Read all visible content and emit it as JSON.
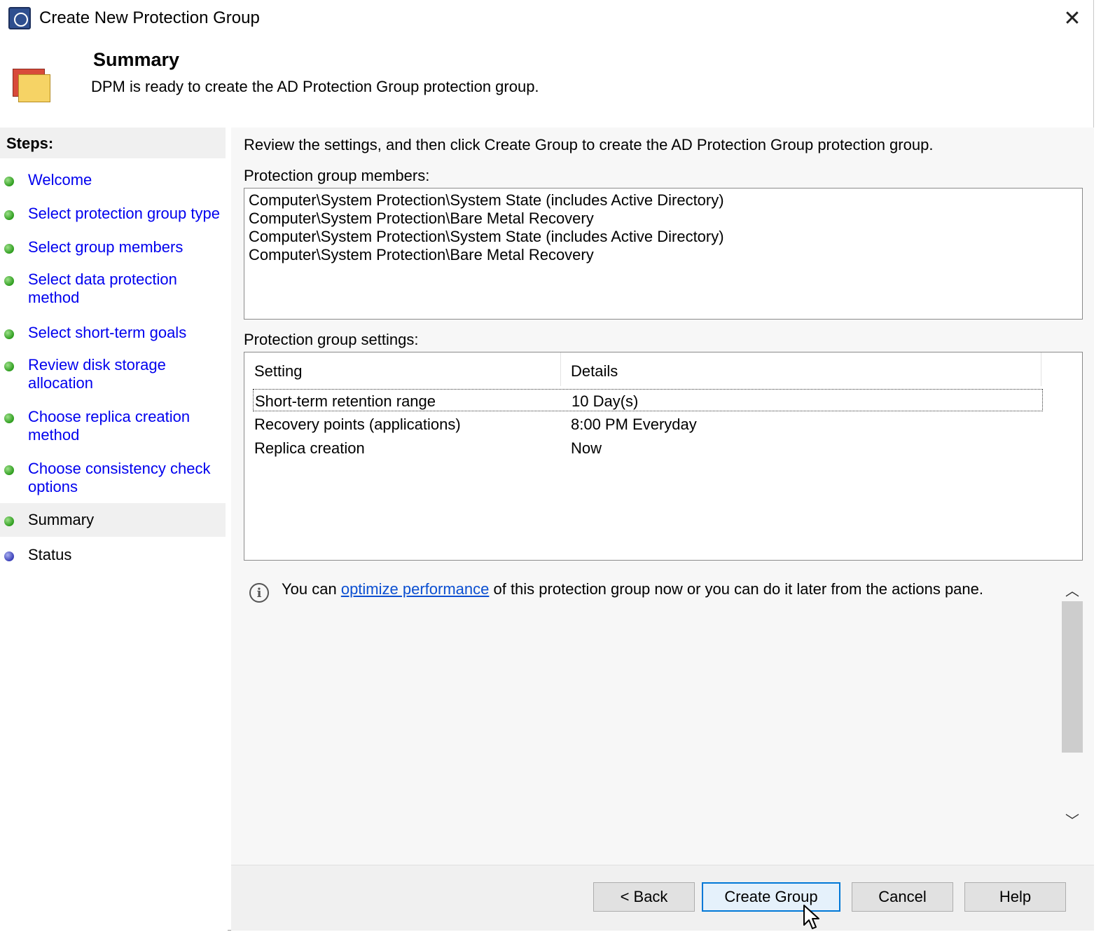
{
  "window": {
    "title": "Create New Protection Group",
    "close_glyph": "✕"
  },
  "header": {
    "title": "Summary",
    "subtitle": "DPM is ready to create the AD Protection Group protection group."
  },
  "steps": {
    "heading": "Steps:",
    "items": [
      {
        "label": "Welcome",
        "state": "done"
      },
      {
        "label": "Select protection group type",
        "state": "done"
      },
      {
        "label": "Select group members",
        "state": "done"
      },
      {
        "label": "Select data protection method",
        "state": "done"
      },
      {
        "label": "Select short-term goals",
        "state": "done"
      },
      {
        "label": "Review disk storage allocation",
        "state": "done"
      },
      {
        "label": "Choose replica creation method",
        "state": "done"
      },
      {
        "label": "Choose consistency check options",
        "state": "done"
      },
      {
        "label": "Summary",
        "state": "current"
      },
      {
        "label": "Status",
        "state": "pending"
      }
    ]
  },
  "main": {
    "intro": "Review the settings, and then click Create Group to create the AD Protection Group protection group.",
    "members_label": "Protection group members:",
    "members": [
      "Computer\\System Protection\\System State (includes Active Directory)",
      "Computer\\System Protection\\Bare Metal Recovery",
      "Computer\\System Protection\\System State (includes Active Directory)",
      "Computer\\System Protection\\Bare Metal Recovery"
    ],
    "settings_label": "Protection group settings:",
    "settings_columns": [
      "Setting",
      "Details"
    ],
    "settings_rows": [
      {
        "setting": "Short-term retention range",
        "details": "10 Day(s)"
      },
      {
        "setting": "Recovery points (applications)",
        "details": "8:00 PM Everyday"
      },
      {
        "setting": "Replica creation",
        "details": "Now"
      }
    ],
    "info": {
      "icon": "info-icon",
      "prefix": "You can ",
      "link": "optimize performance",
      "suffix": " of this protection group now or you can do it later from the actions pane."
    }
  },
  "scrollbar": {
    "up_glyph": "︿",
    "down_glyph": "﹀"
  },
  "buttons": {
    "back": "< Back",
    "create": "Create Group",
    "cancel": "Cancel",
    "help": "Help"
  },
  "colors": {
    "link": "#0000ee",
    "step_done": "#2e9d1e",
    "step_pending": "#3a3fb8",
    "primary_border": "#0078d7"
  }
}
